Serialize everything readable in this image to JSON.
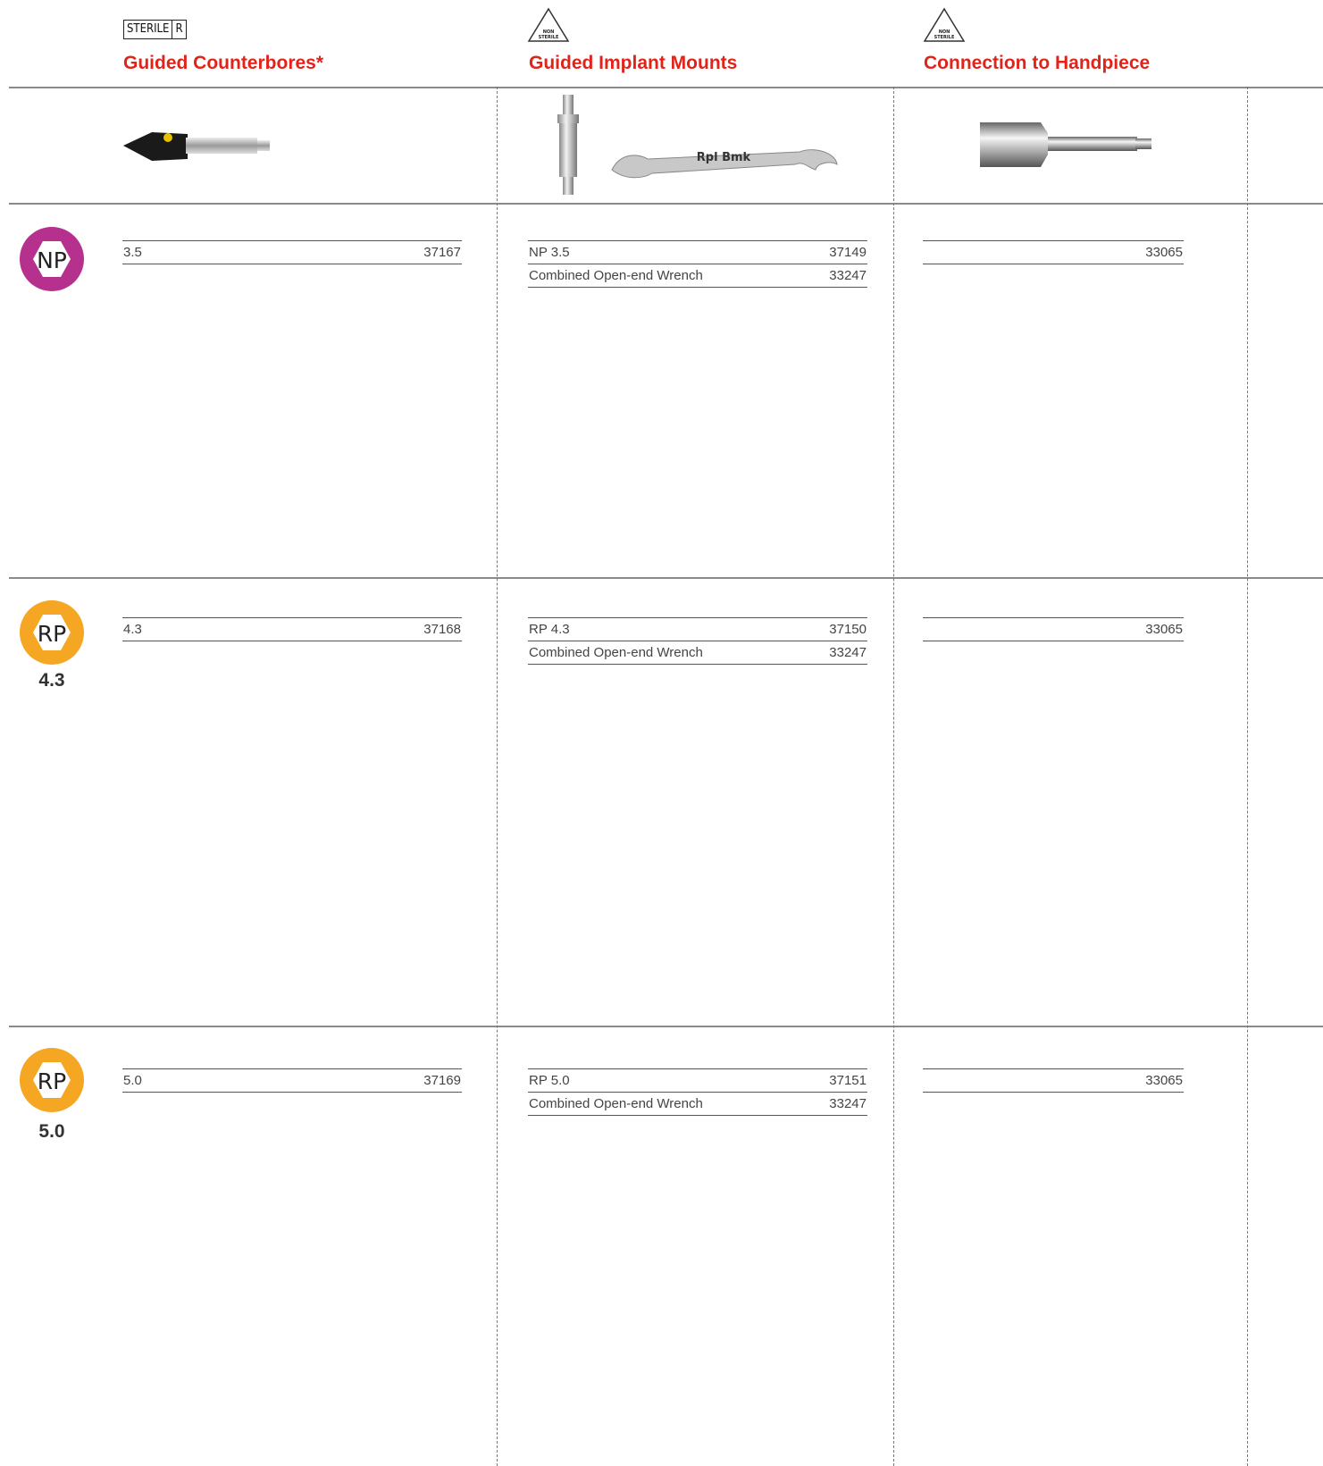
{
  "header": {
    "sterile_symbol": [
      "STERILE",
      "R"
    ],
    "non_sterile_symbol": [
      "NON",
      "STERILE"
    ],
    "columns": [
      {
        "title": "Guided Counterbores*"
      },
      {
        "title": "Guided Implant Mounts"
      },
      {
        "title": "Connection to Handpiece"
      }
    ]
  },
  "images": {
    "mount_wrench_text": "Rpl  Bmk"
  },
  "sections": [
    {
      "badge": {
        "label": "NP",
        "color": "#b5318d"
      },
      "size_label": "",
      "counterbores": [
        {
          "name": "3.5",
          "code": "37167"
        }
      ],
      "mounts": [
        {
          "name": "NP 3.5",
          "code": "37149"
        },
        {
          "name": "Combined Open-end Wrench",
          "code": "33247"
        }
      ],
      "handpiece": [
        {
          "name": "",
          "code": "33065"
        }
      ]
    },
    {
      "badge": {
        "label": "RP",
        "color": "#f5a623"
      },
      "size_label": "4.3",
      "counterbores": [
        {
          "name": "4.3",
          "code": "37168"
        }
      ],
      "mounts": [
        {
          "name": "RP 4.3",
          "code": "37150"
        },
        {
          "name": "Combined Open-end Wrench",
          "code": "33247"
        }
      ],
      "handpiece": [
        {
          "name": "",
          "code": "33065"
        }
      ]
    },
    {
      "badge": {
        "label": "RP",
        "color": "#f5a623"
      },
      "size_label": "5.0",
      "counterbores": [
        {
          "name": "5.0",
          "code": "37169"
        }
      ],
      "mounts": [
        {
          "name": "RP 5.0",
          "code": "37151"
        },
        {
          "name": "Combined Open-end Wrench",
          "code": "33247"
        }
      ],
      "handpiece": [
        {
          "name": "",
          "code": "33065"
        }
      ]
    }
  ]
}
